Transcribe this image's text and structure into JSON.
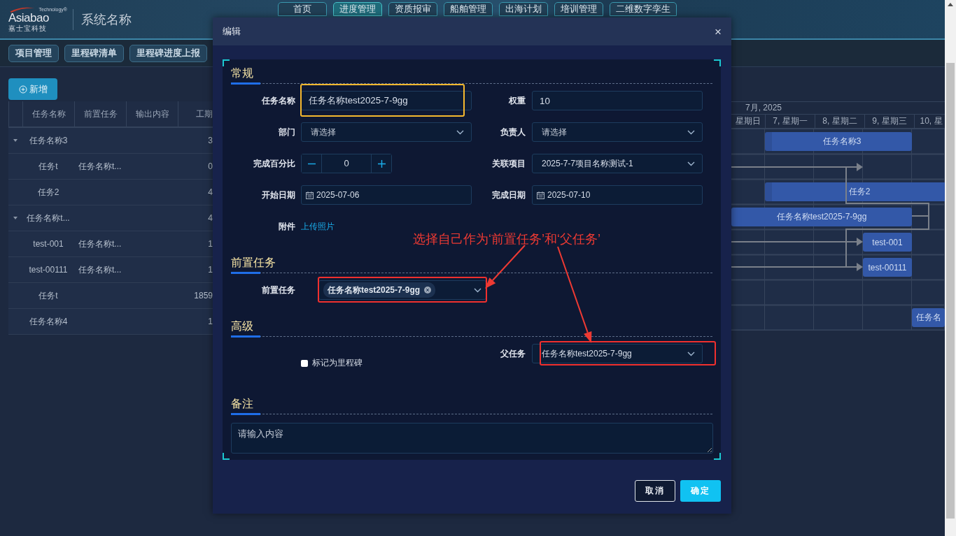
{
  "header": {
    "logo": {
      "tagline": "Technology®",
      "brand": "Asiabao",
      "subtitle": "嘉士宝科技"
    },
    "system_name": "系统名称",
    "nav_tabs": [
      {
        "label": "首页",
        "selected": false
      },
      {
        "label": "进度管理",
        "selected": true
      },
      {
        "label": "资质报审",
        "selected": false
      },
      {
        "label": "船舶管理",
        "selected": false
      },
      {
        "label": "出海计划",
        "selected": false
      },
      {
        "label": "培训管理",
        "selected": false
      },
      {
        "label": "二维数字孪生",
        "selected": false
      }
    ],
    "sub_tabs": [
      {
        "label": "项目管理"
      },
      {
        "label": "里程碑清单"
      },
      {
        "label": "里程碑进度上报"
      }
    ]
  },
  "task_table": {
    "add_button": "新增",
    "columns": [
      "任务名称",
      "前置任务",
      "输出内容",
      "工期"
    ],
    "rows": [
      {
        "name": "任务名称3",
        "duration": "3",
        "expanded": true,
        "children": [
          {
            "name": "任务t",
            "predecessor": "任务名称t...",
            "duration": "0"
          },
          {
            "name": "任务2",
            "duration": "4"
          }
        ]
      },
      {
        "name": "任务名称t...",
        "duration": "4",
        "expanded": true,
        "children": [
          {
            "name": "test-001",
            "predecessor": "任务名称t...",
            "duration": "1"
          },
          {
            "name": "test-00111",
            "predecessor": "任务名称t...",
            "duration": "1"
          },
          {
            "name": "任务t",
            "duration": "1859"
          }
        ]
      },
      {
        "name": "任务名称4",
        "duration": "1"
      }
    ]
  },
  "gantt": {
    "month": "7月, 2025",
    "days": [
      "星期日",
      "7, 星期一",
      "8, 星期二",
      "9, 星期三",
      "10, 星"
    ],
    "bars": [
      {
        "label": "任务名称3"
      },
      {
        "label": "任务2"
      },
      {
        "label": "任务名称test2025-7-9gg"
      },
      {
        "label": "test-001"
      },
      {
        "label": "test-00111"
      },
      {
        "label": "任务名"
      }
    ]
  },
  "dialog": {
    "title": "编辑",
    "close": "×",
    "sections": [
      {
        "title": "常规",
        "fields": [
          {
            "kind": "text",
            "label": "任务名称",
            "value": "任务名称test2025-7-9gg"
          },
          {
            "kind": "text",
            "label": "权重",
            "value": "10"
          },
          {
            "kind": "select",
            "label": "部门",
            "placeholder": "请选择"
          },
          {
            "kind": "select",
            "label": "负责人",
            "placeholder": "请选择"
          },
          {
            "kind": "stepper",
            "label": "完成百分比",
            "value": "0"
          },
          {
            "kind": "select",
            "label": "关联项目",
            "value": "2025-7-7项目名称测试-1"
          },
          {
            "kind": "date",
            "label": "开始日期",
            "value": "2025-07-06"
          },
          {
            "kind": "date",
            "label": "完成日期",
            "value": "2025-07-10"
          },
          {
            "kind": "link",
            "label": "附件",
            "text": "上传照片"
          }
        ]
      },
      {
        "title": "前置任务",
        "fields": [
          {
            "kind": "tags",
            "label": "前置任务",
            "tags": [
              "任务名称test2025-7-9gg"
            ]
          }
        ]
      },
      {
        "title": "高级",
        "fields": [
          {
            "kind": "checkbox",
            "label": "标记为里程碑",
            "checked": false
          },
          {
            "kind": "select",
            "label": "父任务",
            "value": "任务名称test2025-7-9gg"
          }
        ]
      },
      {
        "title": "备注",
        "fields": [
          {
            "kind": "textarea",
            "placeholder": "请输入内容"
          }
        ]
      }
    ],
    "buttons": [
      {
        "label": "取消",
        "kind": "secondary"
      },
      {
        "label": "确定",
        "kind": "primary"
      }
    ]
  },
  "annotation": {
    "text": "选择自己作为‘前置任务’和‘父任务’",
    "highlights": [
      {
        "color": "#f5b82e"
      },
      {
        "color": "#f0302e"
      },
      {
        "color": "#f0302e"
      }
    ]
  }
}
